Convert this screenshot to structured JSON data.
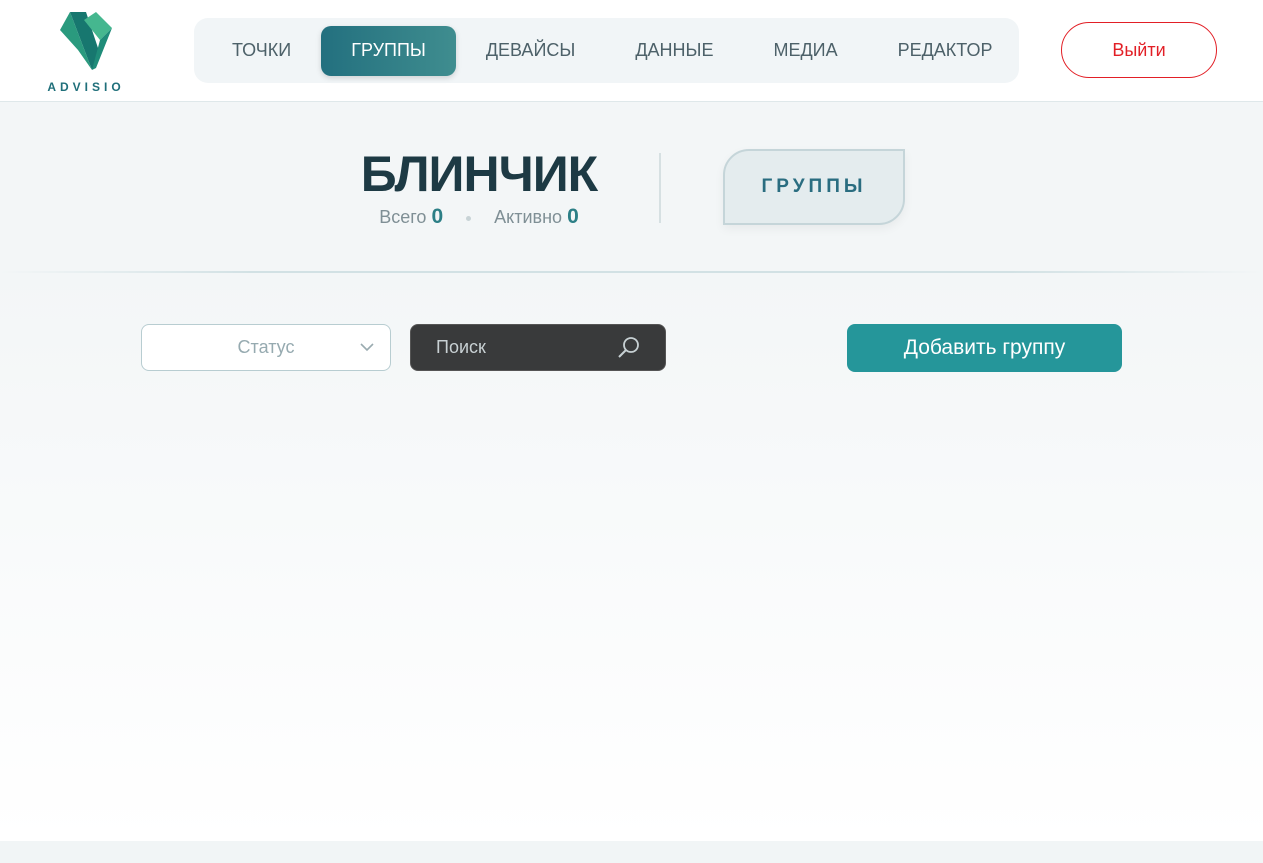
{
  "brand": {
    "logo_text": "ADVISIO"
  },
  "nav": {
    "items": [
      {
        "label": "ТОЧКИ",
        "active": false
      },
      {
        "label": "ГРУППЫ",
        "active": true
      },
      {
        "label": "ДЕВАЙСЫ",
        "active": false
      },
      {
        "label": "ДАННЫЕ",
        "active": false
      },
      {
        "label": "МЕДИА",
        "active": false
      },
      {
        "label": "РЕДАКТОР",
        "active": false
      }
    ]
  },
  "header": {
    "logout_label": "Выйти"
  },
  "hero": {
    "title": "БЛИНЧИК",
    "total_label": "Всего",
    "total_value": "0",
    "active_label": "Активно",
    "active_value": "0",
    "section_badge": "ГРУППЫ"
  },
  "toolbar": {
    "status_placeholder": "Статус",
    "search_placeholder": "Поиск",
    "add_button_label": "Добавить группу"
  },
  "colors": {
    "accent": "#25969a",
    "nav_active": "#23707f",
    "logout": "#e21f26",
    "title": "#1d3a44"
  },
  "icons": {
    "status_chevron": "chevron-down-icon",
    "search": "search-icon"
  }
}
